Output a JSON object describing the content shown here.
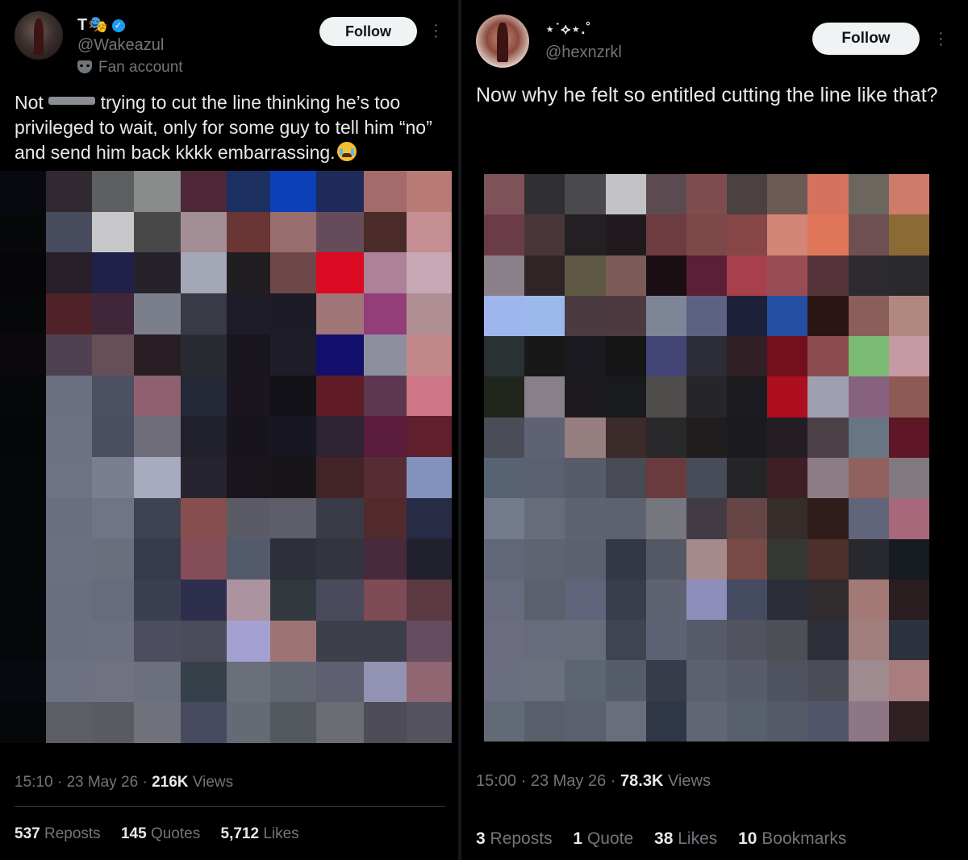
{
  "left": {
    "author": {
      "display_name": "T🎭",
      "handle": "@Wakeazul",
      "badge": "Fan account"
    },
    "follow_label": "Follow",
    "more_label": "⋮",
    "text_before": "Not ",
    "text_after": " trying to cut the line thinking he’s too privileged to wait, only for some guy to tell him “no” and send him back kkkk embarrassing.",
    "time": "15:10",
    "date": "23 May 26",
    "views_count": "216K",
    "views_label": "Views",
    "stats": [
      {
        "count": "537",
        "label": "Reposts"
      },
      {
        "count": "145",
        "label": "Quotes"
      },
      {
        "count": "5,712",
        "label": "Likes"
      }
    ],
    "mosaic_colors": [
      "#080811",
      "#312831",
      "#5e5f60",
      "#898a8a",
      "#4d2737",
      "#1b2f61",
      "#0b40b9",
      "#202a5a",
      "#a56a6c",
      "#b97b76",
      "#06080a",
      "#474b5d",
      "#c7c7c9",
      "#494848",
      "#a28e94",
      "#6a3535",
      "#996e6f",
      "#664c5b",
      "#4b2b2a",
      "#c48e92",
      "#060609",
      "#271f2a",
      "#1f2148",
      "#25222c",
      "#a3a7b6",
      "#211e22",
      "#6e4848",
      "#db0a22",
      "#ad8198",
      "#c8a8b4",
      "#060709",
      "#4f2129",
      "#41263a",
      "#7b7f8c",
      "#383a45",
      "#1e1c29",
      "#1d1b26",
      "#a07578",
      "#933d79",
      "#b08f94",
      "#0b080e",
      "#4f4152",
      "#664f56",
      "#2a1e25",
      "#2a2a32",
      "#18151e",
      "#1f1d2a",
      "#130f6d",
      "#8d8f9f",
      "#c28889",
      "#05070a",
      "#6b7080",
      "#4c5061",
      "#8f6170",
      "#252837",
      "#1a151f",
      "#131118",
      "#5f1c26",
      "#5d3650",
      "#cf7789",
      "#050608",
      "#6c7184",
      "#4b4e5f",
      "#6f6d79",
      "#20212b",
      "#18141d",
      "#181620",
      "#2d2333",
      "#5c1c3c",
      "#5f1f2c",
      "#060709",
      "#6e7284",
      "#7a7e8e",
      "#a8abbf",
      "#26252f",
      "#1a151c",
      "#181519",
      "#432426",
      "#572d34",
      "#8392bc",
      "#060709",
      "#6a6e80",
      "#6f7587",
      "#3e4252",
      "#864f4d",
      "#5b5b66",
      "#5e5e6a",
      "#393c46",
      "#522a2d",
      "#282b45",
      "#060709",
      "#6b6f80",
      "#6a6f7d",
      "#363a4b",
      "#854d57",
      "#535a6b",
      "#2d3039",
      "#34343f",
      "#472a3b",
      "#21212d",
      "#06070a",
      "#6a6e80",
      "#676b7c",
      "#3c3f52",
      "#2d2f4c",
      "#ad939f",
      "#31393f",
      "#4a4a5c",
      "#7d4c57",
      "#5b3a43",
      "#06070a",
      "#6b6e7e",
      "#6c6f7f",
      "#4c4e60",
      "#4c4b5a",
      "#a5a0d2",
      "#9c7474",
      "#3d3f4a",
      "#3d3e47",
      "#664c5e",
      "#080810",
      "#6e7182",
      "#70737f",
      "#6c707c",
      "#364049",
      "#6b6f7a",
      "#626670",
      "#5e5f70",
      "#9293b3",
      "#8f6672",
      "#060709",
      "#5c5e66",
      "#5a5b62",
      "#6f727b",
      "#484b60",
      "#666a74",
      "#54585f",
      "#6a6c73",
      "#4e4c58",
      "#54535f"
    ]
  },
  "right": {
    "author": {
      "display_name": "⋆˙⟡⋆.˚",
      "handle": "@hexnzrkl"
    },
    "follow_label": "Follow",
    "more_label": "⋮",
    "text": "Now why he felt so entitled cutting the line like that?",
    "time": "15:00",
    "date": "23 May 26",
    "views_count": "78.3K",
    "views_label": "Views",
    "stats": [
      {
        "count": "3",
        "label": "Reposts"
      },
      {
        "count": "1",
        "label": "Quote"
      },
      {
        "count": "38",
        "label": "Likes"
      },
      {
        "count": "10",
        "label": "Bookmarks"
      }
    ],
    "mosaic_colors": [
      "#7d5259",
      "#303032",
      "#4a4a4c",
      "#c2c2c4",
      "#5c4a51",
      "#7f4d4e",
      "#4a4140",
      "#6e5a55",
      "#d5725e",
      "#6c675e",
      "#cf7b69",
      "#6a3c48",
      "#483638",
      "#231f22",
      "#201a1e",
      "#6d3c40",
      "#7d4848",
      "#874646",
      "#d48676",
      "#e07659",
      "#6e5052",
      "#8b6a35",
      "#8a8089",
      "#2f2426",
      "#5e5845",
      "#7b5b57",
      "#1b0e12",
      "#5b2035",
      "#a8404c",
      "#984d55",
      "#54333a",
      "#2d2b30",
      "#2a2a2d",
      "#9fb5ee",
      "#9db9ec",
      "#4b3a3f",
      "#4d3a40",
      "#7e8597",
      "#5d6283",
      "#1c2139",
      "#244fa3",
      "#2b1514",
      "#8a5e59",
      "#b08880",
      "#293133",
      "#181819",
      "#1b1a20",
      "#151516",
      "#424575",
      "#2d2d38",
      "#312025",
      "#73101b",
      "#8b4c4f",
      "#7aba72",
      "#c69aa4",
      "#21261d",
      "#87808a",
      "#1d1a1f",
      "#181a1d",
      "#504d4d",
      "#25252a",
      "#1c1c20",
      "#ad0e20",
      "#a09fb2",
      "#87627e",
      "#8e5b54",
      "#4a4c57",
      "#5e6273",
      "#967e81",
      "#3b2b2a",
      "#29282b",
      "#211c1e",
      "#1b1a1f",
      "#241e24",
      "#4d4148",
      "#677682",
      "#5f1626",
      "#586371",
      "#5b6070",
      "#585c68",
      "#484a54",
      "#6a3b3e",
      "#484b58",
      "#252528",
      "#3e1f26",
      "#8c7c85",
      "#90615f",
      "#817880",
      "#737a8a",
      "#676c7a",
      "#5f6371",
      "#5d6270",
      "#75767e",
      "#433b44",
      "#664546",
      "#362c2a",
      "#301c1b",
      "#616579",
      "#a7687c",
      "#626777",
      "#606472",
      "#5d616f",
      "#343846",
      "#545864",
      "#a68a8b",
      "#784a45",
      "#353735",
      "#4d2f2b",
      "#27292f",
      "#161a21",
      "#686b7d",
      "#5b606d",
      "#60647a",
      "#3a3e4b",
      "#5f6371",
      "#8e8ebb",
      "#454b60",
      "#2a2c37",
      "#302c2e",
      "#a27974",
      "#2a1d20",
      "#6b6d7f",
      "#676b7b",
      "#676c7b",
      "#404350",
      "#5f6274",
      "#555b69",
      "#51535f",
      "#4d4e56",
      "#2d2f38",
      "#a07f7d",
      "#2e323e",
      "#6b6e80",
      "#6b707f",
      "#5d6472",
      "#565d6a",
      "#363c49",
      "#5d616f",
      "#585c69",
      "#4e535f",
      "#4c4d56",
      "#9f8a8f",
      "#a97c7d",
      "#636a77",
      "#595e6b",
      "#5b606e",
      "#6a6e7b",
      "#2f3645",
      "#616574",
      "#58606d",
      "#555a69",
      "#515569",
      "#8d7787",
      "#2f2123"
    ]
  }
}
